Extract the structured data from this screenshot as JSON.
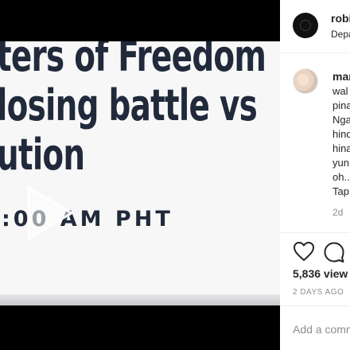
{
  "video": {
    "headline_lines": [
      "ters of Freedom",
      "losing battle vs",
      "ution"
    ],
    "time_text": ":00 AM PHT",
    "play_icon": "play-icon"
  },
  "post": {
    "username": "robi",
    "location": "Depa"
  },
  "comment": {
    "username": "mar",
    "lines": [
      "wal",
      "pina",
      "Nga",
      "hind",
      "hina",
      "yun",
      "oh..",
      "Tap"
    ],
    "time": "2d"
  },
  "actions": {
    "like_icon": "heart-icon",
    "comment_icon": "comment-icon"
  },
  "stats": {
    "views": "5,836 view",
    "posted": "2 DAYS AGO"
  },
  "add_comment": {
    "placeholder": "Add a comm"
  }
}
